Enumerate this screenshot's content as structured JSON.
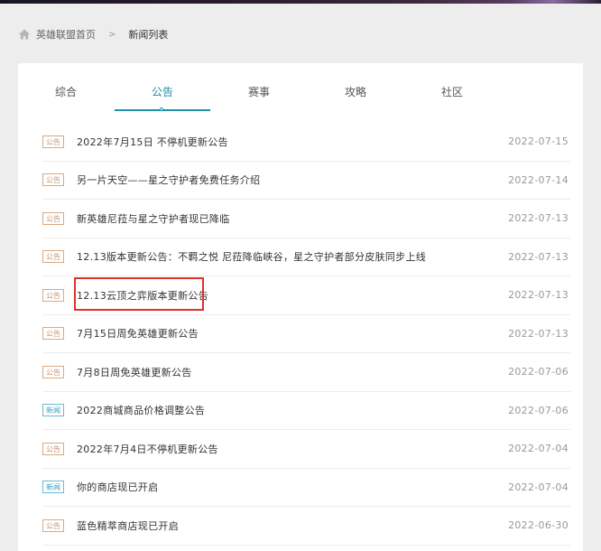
{
  "breadcrumb": {
    "home": "英雄联盟首页",
    "separator": ">",
    "current": "新闻列表"
  },
  "tabs": [
    {
      "label": "综合"
    },
    {
      "label": "公告"
    },
    {
      "label": "赛事"
    },
    {
      "label": "攻略"
    },
    {
      "label": "社区"
    }
  ],
  "active_tab": "公告",
  "colors": {
    "accent": "#1f8fa8",
    "badge_announcement": "#c9936a",
    "badge_news": "#3aa2c0",
    "highlight": "#e0302a"
  },
  "news": [
    {
      "badge": "公告",
      "title": "2022年7月15日 不停机更新公告",
      "date": "2022-07-15"
    },
    {
      "badge": "公告",
      "title": "另一片天空——星之守护者免费任务介绍",
      "date": "2022-07-14"
    },
    {
      "badge": "公告",
      "title": "新英雄尼菈与星之守护者现已降临",
      "date": "2022-07-13"
    },
    {
      "badge": "公告",
      "title": "12.13版本更新公告：不羁之悦 尼菈降临峡谷，星之守护者部分皮肤同步上线",
      "date": "2022-07-13"
    },
    {
      "badge": "公告",
      "title": "12.13云顶之弈版本更新公告",
      "date": "2022-07-13"
    },
    {
      "badge": "公告",
      "title": "7月15日周免英雄更新公告",
      "date": "2022-07-13"
    },
    {
      "badge": "公告",
      "title": "7月8日周免英雄更新公告",
      "date": "2022-07-06"
    },
    {
      "badge": "新闻",
      "title": "2022商城商品价格调整公告",
      "date": "2022-07-06"
    },
    {
      "badge": "公告",
      "title": "2022年7月4日不停机更新公告",
      "date": "2022-07-04"
    },
    {
      "badge": "新闻",
      "title": "你的商店现已开启",
      "date": "2022-07-04"
    },
    {
      "badge": "公告",
      "title": "蓝色精萃商店现已开启",
      "date": "2022-06-30"
    }
  ]
}
